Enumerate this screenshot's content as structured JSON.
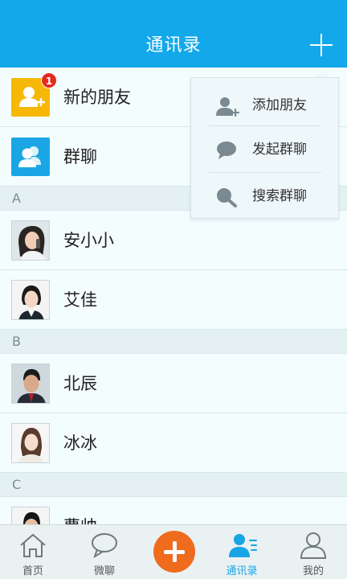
{
  "header": {
    "title": "通讯录"
  },
  "list": {
    "new_friends": {
      "label": "新的朋友",
      "badge": "1"
    },
    "group_chat": {
      "label": "群聊"
    },
    "sections": [
      {
        "letter": "A",
        "contacts": [
          {
            "name": "安小小"
          },
          {
            "name": "艾佳"
          }
        ]
      },
      {
        "letter": "B",
        "contacts": [
          {
            "name": "北辰"
          },
          {
            "name": "冰冰"
          }
        ]
      },
      {
        "letter": "C",
        "contacts": [
          {
            "name": "曹帅"
          }
        ]
      }
    ]
  },
  "popup": {
    "items": [
      {
        "label": "添加朋友",
        "icon": "add-person-icon"
      },
      {
        "label": "发起群聊",
        "icon": "chat-bubble-icon"
      },
      {
        "label": "搜索群聊",
        "icon": "search-icon"
      }
    ]
  },
  "tabbar": {
    "tabs": [
      {
        "label": "首页",
        "icon": "home-icon"
      },
      {
        "label": "微聊",
        "icon": "chat-bubble-icon"
      },
      {
        "label": "通讯录",
        "icon": "contacts-icon",
        "active": true
      },
      {
        "label": "我的",
        "icon": "person-icon"
      }
    ],
    "center": {
      "icon": "plus-icon"
    }
  },
  "colors": {
    "header_bg": "#12a8ea",
    "accent": "#18a5e6",
    "center_button": "#ef6b1e",
    "badge": "#e52a21",
    "new_friends_tile": "#f7b707",
    "group_tile": "#1aa6e5"
  }
}
